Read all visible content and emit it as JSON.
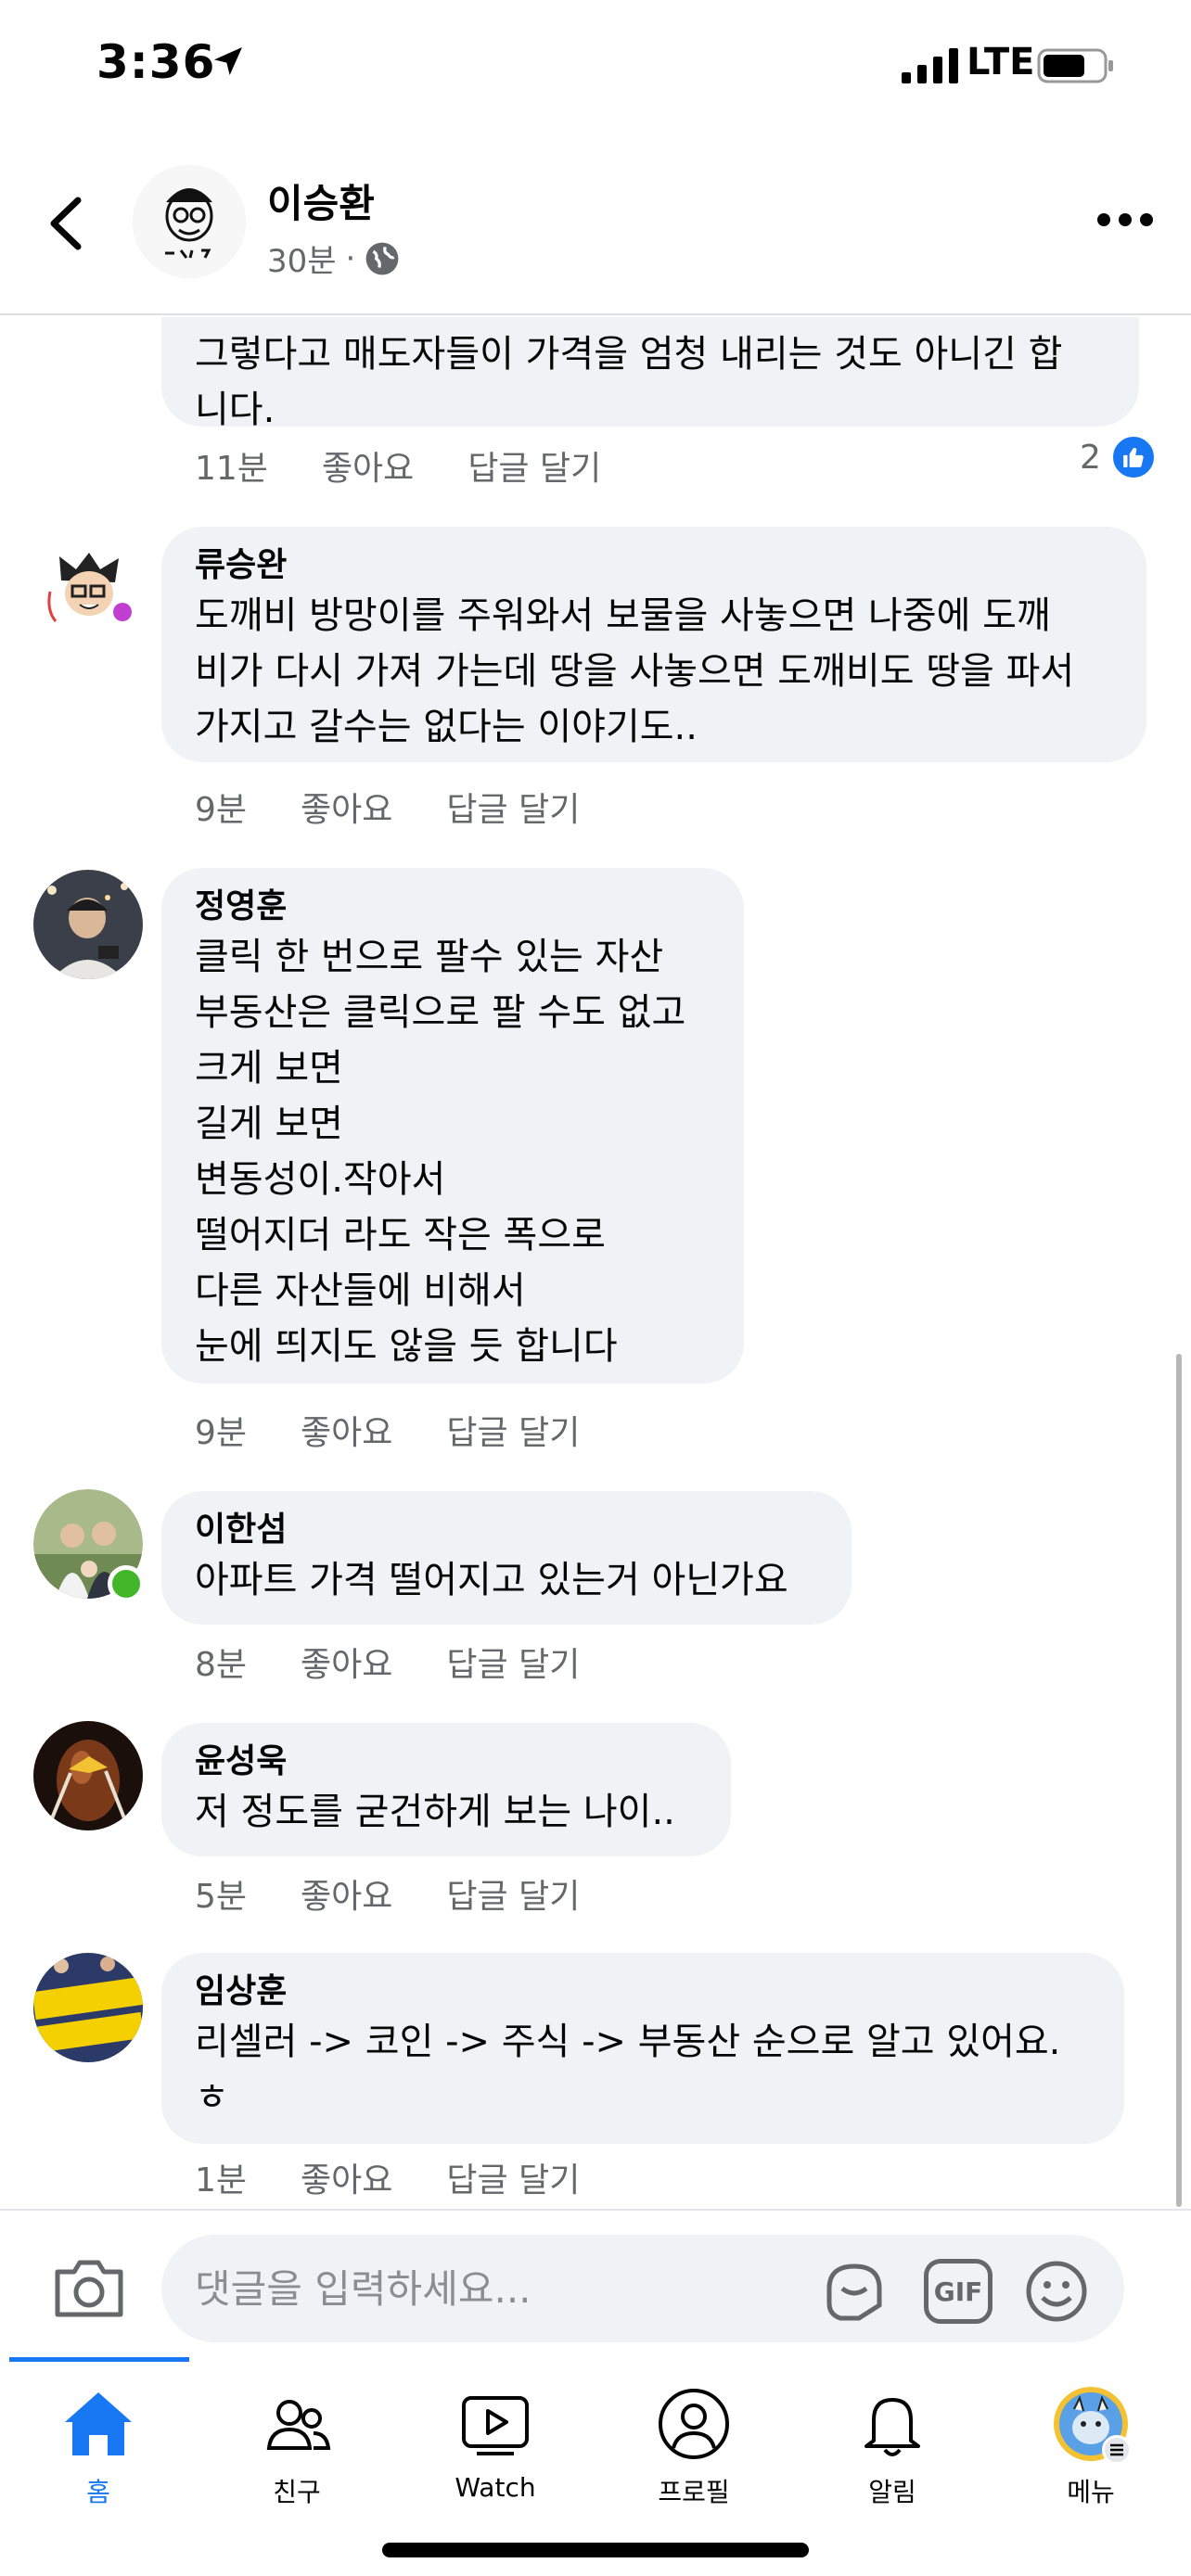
{
  "status_bar": {
    "time": "3:36",
    "network": "LTE"
  },
  "post": {
    "author": "이승환",
    "time": "30분",
    "separator": "·"
  },
  "comments": [
    {
      "name": "",
      "lines": [
        "그렇다고 매도자들이 가격을 엄청 내리는 것도 아니긴 합",
        "니다."
      ],
      "time": "11분",
      "like": "좋아요",
      "reply": "답글 달기",
      "reactions": "2"
    },
    {
      "name": "류승완",
      "lines": [
        "도깨비 방망이를 주워와서 보물을 사놓으면 나중에 도깨",
        "비가 다시 가져 가는데 땅을 사놓으면 도깨비도 땅을 파서",
        "가지고 갈수는 없다는 이야기도.."
      ],
      "time": "9분",
      "like": "좋아요",
      "reply": "답글 달기"
    },
    {
      "name": "정영훈",
      "lines": [
        "클릭 한 번으로 팔수 있는 자산",
        "부동산은 클릭으로 팔 수도 없고",
        "크게 보면",
        "길게 보면",
        "변동성이.작아서",
        "떨어지더 라도 작은 폭으로",
        "다른 자산들에 비해서",
        "눈에 띄지도 않을 듯 합니다"
      ],
      "time": "9분",
      "like": "좋아요",
      "reply": "답글 달기"
    },
    {
      "name": "이한섬",
      "lines": [
        "아파트 가격 떨어지고 있는거 아닌가요"
      ],
      "time": "8분",
      "like": "좋아요",
      "reply": "답글 달기"
    },
    {
      "name": "윤성욱",
      "lines": [
        "저 정도를 굳건하게 보는 나이.."
      ],
      "time": "5분",
      "like": "좋아요",
      "reply": "답글 달기"
    },
    {
      "name": "임상훈",
      "lines": [
        "리셀러 -> 코인 -> 주식 -> 부동산 순으로 알고 있어요.",
        "ㅎ"
      ],
      "time": "1분",
      "like": "좋아요",
      "reply": "답글 달기"
    }
  ],
  "composer": {
    "placeholder": "댓글을 입력하세요...",
    "gif": "GIF"
  },
  "nav": [
    {
      "label": "홈",
      "icon": "home-icon",
      "active": true
    },
    {
      "label": "친구",
      "icon": "friends-icon"
    },
    {
      "label": "Watch",
      "icon": "watch-icon"
    },
    {
      "label": "프로필",
      "icon": "profile-icon"
    },
    {
      "label": "알림",
      "icon": "bell-icon"
    },
    {
      "label": "메뉴",
      "icon": "menu-icon"
    }
  ],
  "colors": {
    "accent": "#1877f2",
    "bubble": "#f0f2f5",
    "secondary_text": "#65676b",
    "online": "#42b72a"
  }
}
